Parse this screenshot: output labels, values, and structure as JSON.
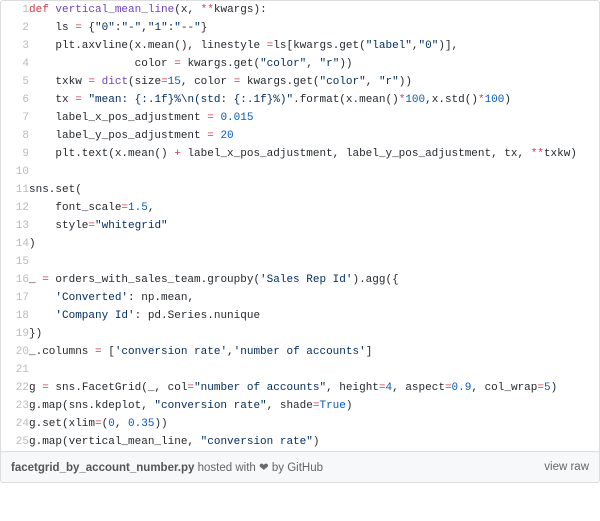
{
  "lines": [
    {
      "n": "1",
      "html": "<span class='kw'>def</span> <span class='fn'>vertical_mean_line</span>(<span class='pa'>x</span>, <span class='op'>**</span><span class='pa'>kwargs</span>):"
    },
    {
      "n": "2",
      "html": "    ls <span class='op'>=</span> {<span class='s'>\"0\"</span>:<span class='s'>\"-\"</span>,<span class='s'>\"1\"</span>:<span class='s'>\"--\"</span>}"
    },
    {
      "n": "3",
      "html": "    plt.axvline(x.mean(), <span class='pa'>linestyle</span> <span class='op'>=</span>ls[kwargs.get(<span class='s'>\"label\"</span>,<span class='s'>\"0\"</span>)],"
    },
    {
      "n": "4",
      "html": "                <span class='pa'>color</span> <span class='op'>=</span> kwargs.get(<span class='s'>\"color\"</span>, <span class='s'>\"r\"</span>))"
    },
    {
      "n": "5",
      "html": "    txkw <span class='op'>=</span> <span class='fn'>dict</span>(<span class='pa'>size</span><span class='op'>=</span><span class='n'>15</span>, <span class='pa'>color</span> <span class='op'>=</span> kwargs.get(<span class='s'>\"color\"</span>, <span class='s'>\"r\"</span>))"
    },
    {
      "n": "6",
      "html": "    tx <span class='op'>=</span> <span class='s'>\"mean: {:.1f}%<span>\\n</span>(std: {:.1f}%)\"</span>.format(x.mean()<span class='op'>*</span><span class='n'>100</span>,x.std()<span class='op'>*</span><span class='n'>100</span>)"
    },
    {
      "n": "7",
      "html": "    label_x_pos_adjustment <span class='op'>=</span> <span class='n'>0.015</span>"
    },
    {
      "n": "8",
      "html": "    label_y_pos_adjustment <span class='op'>=</span> <span class='n'>20</span>"
    },
    {
      "n": "9",
      "html": "    plt.text(x.mean() <span class='op'>+</span> label_x_pos_adjustment, label_y_pos_adjustment, tx, <span class='op'>**</span>txkw)"
    },
    {
      "n": "10",
      "html": ""
    },
    {
      "n": "11",
      "html": "sns.set("
    },
    {
      "n": "12",
      "html": "    <span class='pa'>font_scale</span><span class='op'>=</span><span class='n'>1.5</span>,"
    },
    {
      "n": "13",
      "html": "    <span class='pa'>style</span><span class='op'>=</span><span class='s'>\"whitegrid\"</span>"
    },
    {
      "n": "14",
      "html": ")"
    },
    {
      "n": "15",
      "html": ""
    },
    {
      "n": "16",
      "html": "_ <span class='op'>=</span> orders_with_sales_team.groupby(<span class='s'>'Sales Rep Id'</span>).agg({"
    },
    {
      "n": "17",
      "html": "    <span class='s'>'Converted'</span>: np.mean,"
    },
    {
      "n": "18",
      "html": "    <span class='s'>'Company Id'</span>: pd.Series.nunique"
    },
    {
      "n": "19",
      "html": "})"
    },
    {
      "n": "20",
      "html": "_.columns <span class='op'>=</span> [<span class='s'>'conversion rate'</span>,<span class='s'>'number of accounts'</span>]"
    },
    {
      "n": "21",
      "html": ""
    },
    {
      "n": "22",
      "html": "g <span class='op'>=</span> sns.FacetGrid(_, <span class='pa'>col</span><span class='op'>=</span><span class='s'>\"number of accounts\"</span>, <span class='pa'>height</span><span class='op'>=</span><span class='n'>4</span>, <span class='pa'>aspect</span><span class='op'>=</span><span class='n'>0.9</span>, <span class='pa'>col_wrap</span><span class='op'>=</span><span class='n'>5</span>)"
    },
    {
      "n": "23",
      "html": "g.map(sns.kdeplot, <span class='s'>\"conversion rate\"</span>, <span class='pa'>shade</span><span class='op'>=</span><span class='n'>True</span>)"
    },
    {
      "n": "24",
      "html": "g.set(<span class='pa'>xlim</span><span class='op'>=</span>(<span class='n'>0</span>, <span class='n'>0.35</span>))"
    },
    {
      "n": "25",
      "html": "g.map(vertical_mean_line, <span class='s'>\"conversion rate\"</span>)"
    }
  ],
  "footer": {
    "filename": "facetgrid_by_account_number.py",
    "hosted_prefix": " hosted with ",
    "heart": "❤",
    "by": " by ",
    "host": "GitHub",
    "raw": "view raw"
  }
}
